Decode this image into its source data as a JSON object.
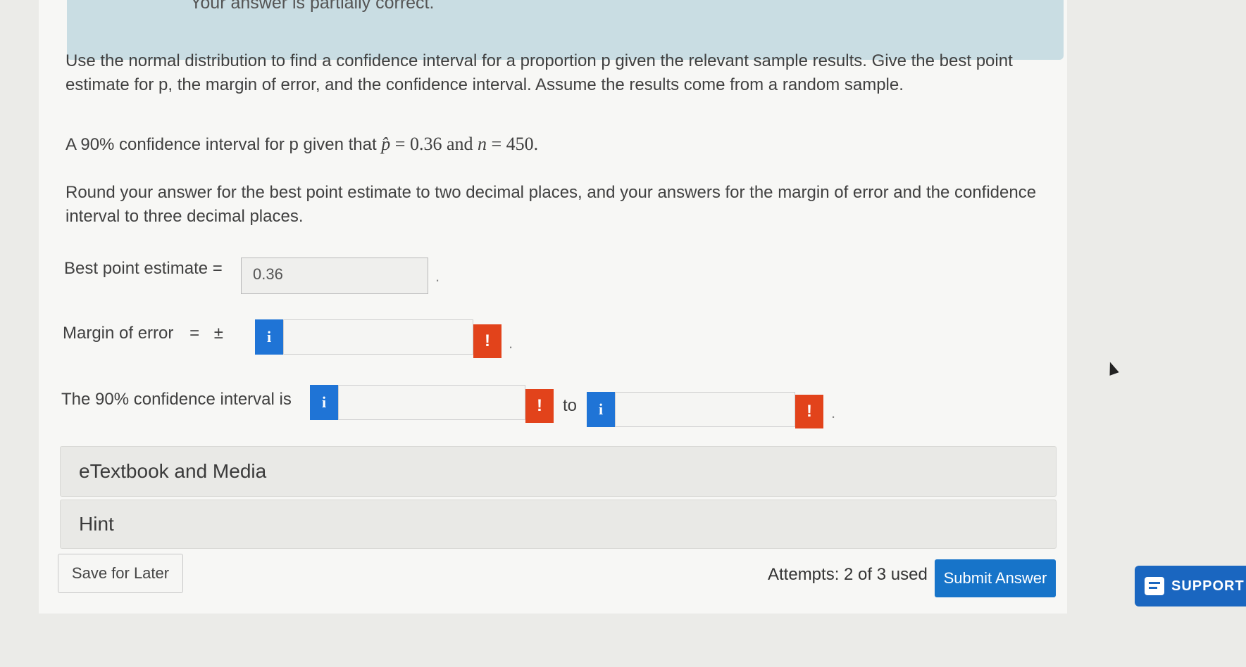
{
  "banner": {
    "status_text": "Your answer is partially correct."
  },
  "question": {
    "line1": "Use the normal distribution to find a confidence interval for a proportion p given the relevant sample results. Give the best point",
    "line2": "estimate for p, the margin of error, and the confidence interval. Assume the results come from a random sample.",
    "given_prefix": "A 90% confidence interval for p given that",
    "phat_symbol": "p̂",
    "phat_eq": " = 0.36 and ",
    "n_symbol": "n",
    "n_eq": " = 450.",
    "round_line1": "Round your answer for the best point estimate to two decimal places, and your answers for the margin of error and the confidence",
    "round_line2": "interval to three decimal places."
  },
  "best_point": {
    "label": "Best point estimate =",
    "value": "0.36"
  },
  "margin": {
    "label": "Margin of error",
    "eq": "=",
    "pm": "±",
    "info": "i",
    "value": "",
    "error": "!"
  },
  "interval": {
    "label": "The 90% confidence interval is",
    "info": "i",
    "lower_value": "",
    "upper_value": "",
    "error": "!",
    "to": "to"
  },
  "sections": {
    "etextbook": "eTextbook and Media",
    "hint": "Hint"
  },
  "footer": {
    "save_label": "Save for Later",
    "attempts": "Attempts: 2 of 3 used",
    "submit_label": "Submit Answer",
    "support_label": "SUPPORT"
  },
  "colors": {
    "info_blue": "#1f74d6",
    "error_red": "#e2431b",
    "submit_blue": "#1774c9",
    "banner": "#c9dde3"
  }
}
